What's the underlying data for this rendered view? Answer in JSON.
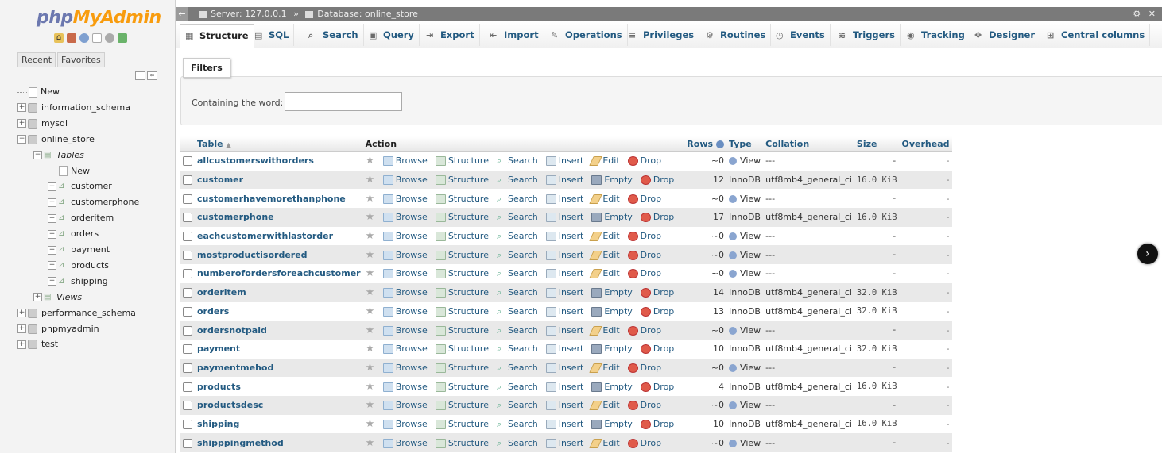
{
  "logo": {
    "php": "php",
    "myadmin": "MyAdmin"
  },
  "nav": {
    "recent_tab": "Recent",
    "favorites_tab": "Favorites",
    "tree": [
      {
        "label": "New",
        "indent": 0,
        "kind": "new"
      },
      {
        "label": "information_schema",
        "indent": 0,
        "kind": "db"
      },
      {
        "label": "mysql",
        "indent": 0,
        "kind": "db"
      },
      {
        "label": "online_store",
        "indent": 0,
        "kind": "db"
      },
      {
        "label": "Tables",
        "indent": 1,
        "kind": "group"
      },
      {
        "label": "New",
        "indent": 2,
        "kind": "new"
      },
      {
        "label": "customer",
        "indent": 2,
        "kind": "table"
      },
      {
        "label": "customerphone",
        "indent": 2,
        "kind": "table"
      },
      {
        "label": "orderitem",
        "indent": 2,
        "kind": "table"
      },
      {
        "label": "orders",
        "indent": 2,
        "kind": "table"
      },
      {
        "label": "payment",
        "indent": 2,
        "kind": "table"
      },
      {
        "label": "products",
        "indent": 2,
        "kind": "table"
      },
      {
        "label": "shipping",
        "indent": 2,
        "kind": "table"
      },
      {
        "label": "Views",
        "indent": 1,
        "kind": "group"
      },
      {
        "label": "performance_schema",
        "indent": 0,
        "kind": "db"
      },
      {
        "label": "phpmyadmin",
        "indent": 0,
        "kind": "db"
      },
      {
        "label": "test",
        "indent": 0,
        "kind": "db"
      }
    ]
  },
  "topbar": {
    "server": "Server: 127.0.0.1",
    "sep": "»",
    "database": "Database: online_store"
  },
  "menu": {
    "tabs": [
      {
        "label": "Structure",
        "icon": "structure-icon"
      },
      {
        "label": "SQL",
        "icon": "sql-icon"
      },
      {
        "label": "Search",
        "icon": "search-icon"
      },
      {
        "label": "Query",
        "icon": "query-icon"
      },
      {
        "label": "Export",
        "icon": "export-icon"
      },
      {
        "label": "Import",
        "icon": "import-icon"
      },
      {
        "label": "Operations",
        "icon": "operations-icon"
      },
      {
        "label": "Privileges",
        "icon": "privileges-icon"
      },
      {
        "label": "Routines",
        "icon": "routines-icon"
      },
      {
        "label": "Events",
        "icon": "events-icon"
      },
      {
        "label": "Triggers",
        "icon": "triggers-icon"
      },
      {
        "label": "Tracking",
        "icon": "tracking-icon"
      },
      {
        "label": "Designer",
        "icon": "designer-icon"
      },
      {
        "label": "Central columns",
        "icon": "central-columns-icon"
      }
    ]
  },
  "filters": {
    "legend": "Filters",
    "label": "Containing the word:",
    "value": ""
  },
  "table": {
    "headers": {
      "table": "Table",
      "sort": "▲",
      "action": "Action",
      "rows": "Rows",
      "type": "Type",
      "collation": "Collation",
      "size": "Size",
      "overhead": "Overhead"
    },
    "actions": {
      "browse": "Browse",
      "structure": "Structure",
      "search": "Search",
      "insert": "Insert",
      "edit": "Edit",
      "empty": "Empty",
      "drop": "Drop"
    },
    "rows": [
      {
        "name": "allcustomerswithorders",
        "rows": "~0",
        "type": "View",
        "collation": "---",
        "size": "-",
        "overhead": "-",
        "is_view": true
      },
      {
        "name": "customer",
        "rows": "12",
        "type": "InnoDB",
        "collation": "utf8mb4_general_ci",
        "size": "16.0 KiB",
        "overhead": "-",
        "is_view": false
      },
      {
        "name": "customerhavemorethanphone",
        "rows": "~0",
        "type": "View",
        "collation": "---",
        "size": "-",
        "overhead": "-",
        "is_view": true
      },
      {
        "name": "customerphone",
        "rows": "17",
        "type": "InnoDB",
        "collation": "utf8mb4_general_ci",
        "size": "16.0 KiB",
        "overhead": "-",
        "is_view": false
      },
      {
        "name": "eachcustomerwithlastorder",
        "rows": "~0",
        "type": "View",
        "collation": "---",
        "size": "-",
        "overhead": "-",
        "is_view": true
      },
      {
        "name": "mostproductisordered",
        "rows": "~0",
        "type": "View",
        "collation": "---",
        "size": "-",
        "overhead": "-",
        "is_view": true
      },
      {
        "name": "numberofordersforeachcustomer",
        "rows": "~0",
        "type": "View",
        "collation": "---",
        "size": "-",
        "overhead": "-",
        "is_view": true
      },
      {
        "name": "orderitem",
        "rows": "14",
        "type": "InnoDB",
        "collation": "utf8mb4_general_ci",
        "size": "32.0 KiB",
        "overhead": "-",
        "is_view": false
      },
      {
        "name": "orders",
        "rows": "13",
        "type": "InnoDB",
        "collation": "utf8mb4_general_ci",
        "size": "32.0 KiB",
        "overhead": "-",
        "is_view": false
      },
      {
        "name": "ordersnotpaid",
        "rows": "~0",
        "type": "View",
        "collation": "---",
        "size": "-",
        "overhead": "-",
        "is_view": true
      },
      {
        "name": "payment",
        "rows": "10",
        "type": "InnoDB",
        "collation": "utf8mb4_general_ci",
        "size": "32.0 KiB",
        "overhead": "-",
        "is_view": false
      },
      {
        "name": "paymentmehod",
        "rows": "~0",
        "type": "View",
        "collation": "---",
        "size": "-",
        "overhead": "-",
        "is_view": true
      },
      {
        "name": "products",
        "rows": "4",
        "type": "InnoDB",
        "collation": "utf8mb4_general_ci",
        "size": "16.0 KiB",
        "overhead": "-",
        "is_view": false
      },
      {
        "name": "productsdesc",
        "rows": "~0",
        "type": "View",
        "collation": "---",
        "size": "-",
        "overhead": "-",
        "is_view": true
      },
      {
        "name": "shipping",
        "rows": "10",
        "type": "InnoDB",
        "collation": "utf8mb4_general_ci",
        "size": "16.0 KiB",
        "overhead": "-",
        "is_view": false
      },
      {
        "name": "shipppingmethod",
        "rows": "~0",
        "type": "View",
        "collation": "---",
        "size": "-",
        "overhead": "-",
        "is_view": true
      }
    ]
  },
  "colors": {
    "link": "#235a81",
    "logo_php": "#6c78af",
    "logo_myadmin": "#f89c0e",
    "topbar": "#7a7a7a"
  }
}
